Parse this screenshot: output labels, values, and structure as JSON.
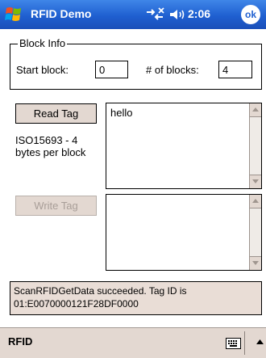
{
  "titlebar": {
    "app_title": "RFID Demo",
    "clock": "2:06",
    "ok_label": "ok",
    "icons": [
      "windows-start-icon",
      "connectivity-icon",
      "volume-icon"
    ]
  },
  "block_info": {
    "legend": "Block Info",
    "start_block_label": "Start block:",
    "start_block_value": "0",
    "num_blocks_label": "# of blocks:",
    "num_blocks_value": "4"
  },
  "read": {
    "button_label": "Read Tag",
    "description": "ISO15693 - 4 bytes per block",
    "textbox_value": "hello"
  },
  "write": {
    "button_label": "Write Tag",
    "button_enabled": false,
    "textbox_value": ""
  },
  "status": {
    "message": "ScanRFIDGetData succeeded. Tag ID is 01:E0070000121F28DF0000"
  },
  "menubar": {
    "menu_label": "RFID",
    "icons": [
      "keyboard-icon",
      "sip-up-arrow-icon"
    ]
  },
  "colors": {
    "titlebar": "#1f5fd0",
    "button_face": "#e3d8d1",
    "status_background": "#e9ddd6"
  }
}
